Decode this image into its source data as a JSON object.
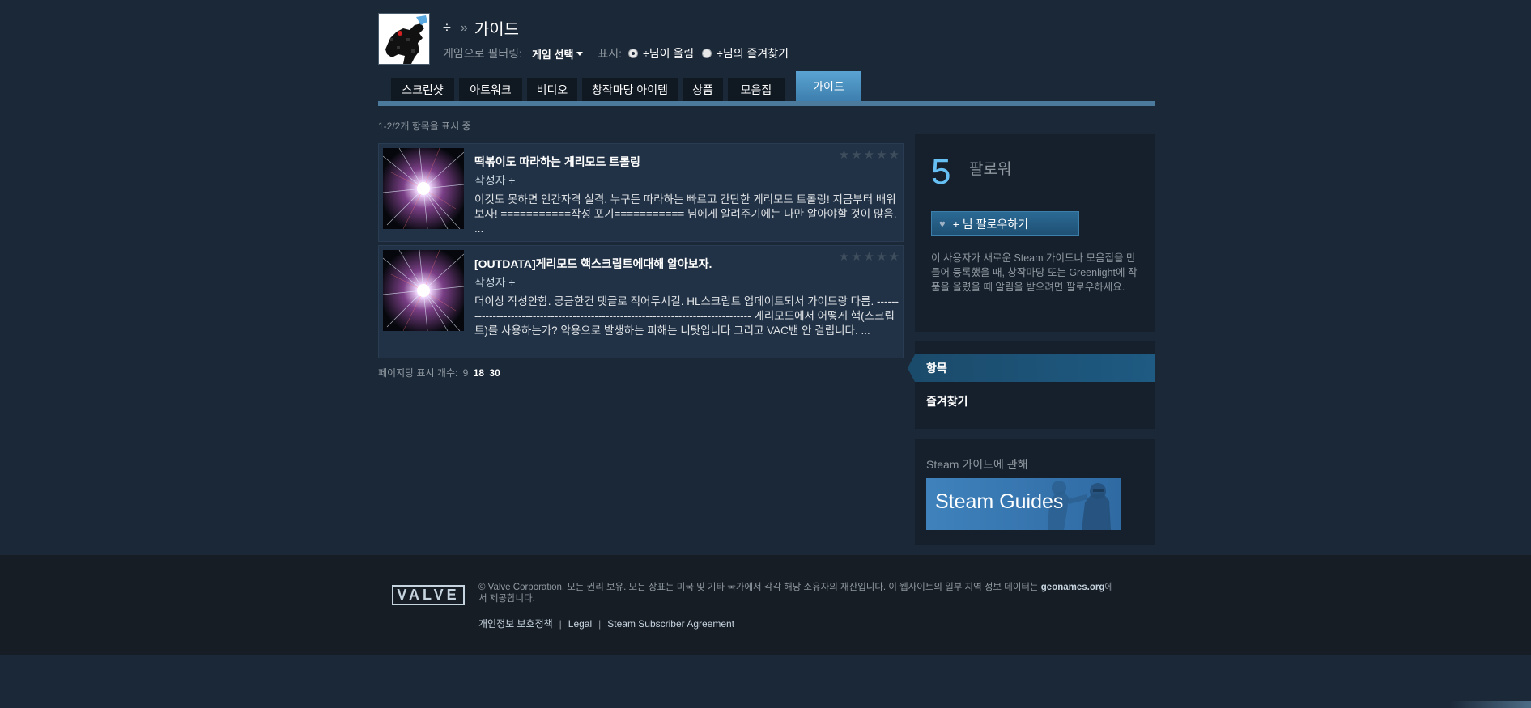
{
  "header": {
    "username": "÷",
    "separator": "»",
    "title": "가이드",
    "filter_label": "게임으로 필터링:",
    "game_select": "게임 선택",
    "show_label": "표시:",
    "radio_option_1": "÷님이 올림",
    "radio_option_2": "÷님의 즐겨찾기"
  },
  "tabs": [
    {
      "label": "스크린샷"
    },
    {
      "label": "아트워크"
    },
    {
      "label": "비디오"
    },
    {
      "label": "창작마당 아이템"
    },
    {
      "label": "상품"
    },
    {
      "label": "모음집"
    },
    {
      "label": "가이드",
      "active": true
    }
  ],
  "results_count": "1-2/2개 항목을 표시 중",
  "guides": [
    {
      "title": "떡볶이도 따라하는 게리모드 트롤링",
      "author": "작성자 ÷",
      "description": "이것도 못하면 인간자격 실격. 누구든 따라하는 빠르고 간단한 게리모드 트롤링! 지금부터 배워보자! ===========작성 포기=========== 님에게 알려주기에는 나만 알아야할 것이 많음. ..."
    },
    {
      "title": "[OUTDATA]게리모드 핵스크립트에대해 알아보자.",
      "author": "작성자 ÷",
      "description": "더이상 작성안함. 궁금한건 댓글로 적어두시길. HL스크립트 업데이트되서 가이드랑 다름. ---------------------------------------------------------------------------------- 게리모드에서 어떻게 핵(스크립트)를 사용하는가? 악용으로 발생하는 피해는 니탓입니다 그리고 VAC밴 안 걸립니다. ..."
    }
  ],
  "per_page": {
    "label": "페이지당 표시 개수:",
    "options": [
      "9",
      "18",
      "30"
    ]
  },
  "follow": {
    "count": "5",
    "label": "팔로워",
    "button": "+ 님 팔로우하기",
    "description": "이 사용자가 새로운 Steam 가이드나 모음집을 만들어 등록했을 때, 창작마당 또는 Greenlight에 작품을 올렸을 때 알림을 받으려면 팔로우하세요."
  },
  "nav": {
    "active": "항목",
    "item": "즐겨찾기"
  },
  "about": {
    "title": "Steam 가이드에 관해",
    "banner": "Steam Guides"
  },
  "footer": {
    "logo": "VALVE",
    "copyright_pre": "© Valve Corporation. 모든 권리 보유. 모든 상표는 미국 및 기타 국가에서 각각 해당 소유자의 재산입니다. 이 웹사이트의 일부 지역 정보 데이터는 ",
    "geonames": "geonames.org",
    "copyright_post": "에서 제공합니다.",
    "links": [
      "개인정보 보호정책",
      "Legal",
      "Steam Subscriber Agreement"
    ]
  },
  "colors": {
    "background": "#1b2838",
    "accent": "#66c0f4",
    "tab_active": "#5aa3d3",
    "footer_bg": "#171d25"
  }
}
